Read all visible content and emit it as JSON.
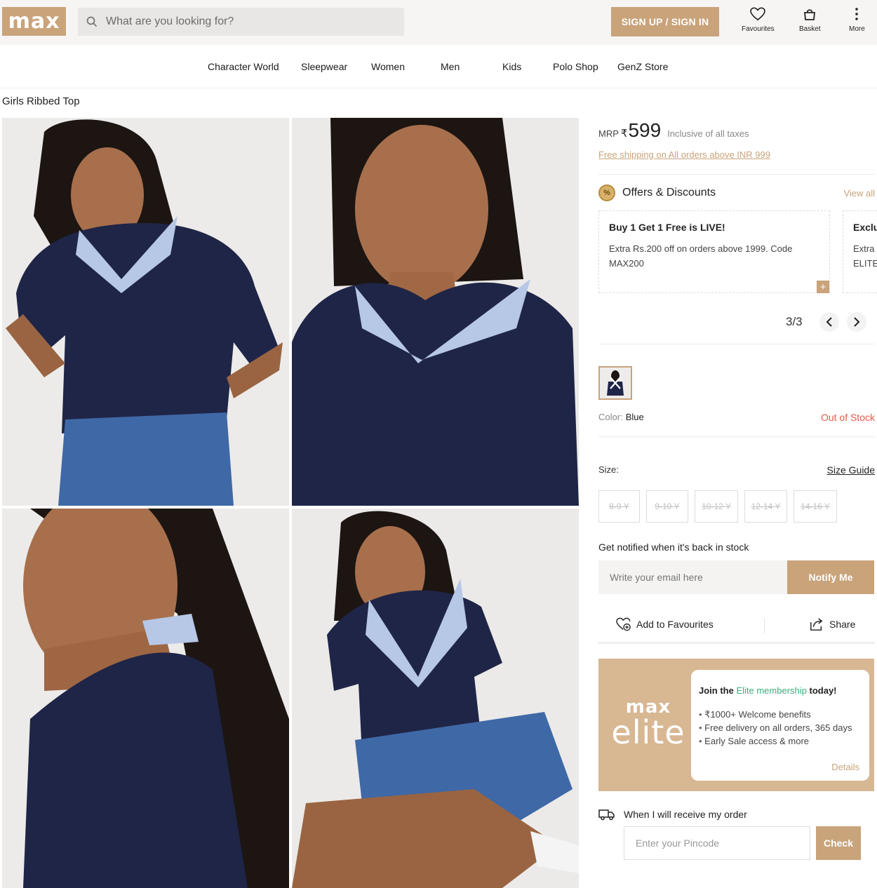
{
  "header": {
    "logo": "max",
    "search_placeholder": "What are you looking for?",
    "signin_label": "SIGN UP / SIGN IN",
    "favourites_label": "Favourites",
    "basket_label": "Basket",
    "more_label": "More"
  },
  "nav": [
    "Character World",
    "Sleepwear",
    "Women",
    "Men",
    "Kids",
    "Polo Shop",
    "GenZ Store"
  ],
  "product": {
    "title": "Girls Ribbed Top",
    "mrp_label": "MRP",
    "currency": "₹",
    "price": "599",
    "tax_note": "Inclusive of all taxes",
    "free_shipping": "Free shipping on All orders above INR 999"
  },
  "offers": {
    "title": "Offers & Discounts",
    "view_all": "View all",
    "badge": "%",
    "cards": [
      {
        "title": "Buy 1 Get 1 Free is LIVE!",
        "line1": "Extra Rs.200 off on orders above 1999. Code",
        "line2": "MAX200"
      },
      {
        "title": "Exclu",
        "line1": "Extra",
        "line2": "ELITE"
      }
    ],
    "pager": "3/3"
  },
  "color": {
    "label": "Color:",
    "value": "Blue",
    "stock": "Out of Stock"
  },
  "size": {
    "label": "Size:",
    "guide": "Size Guide",
    "options": [
      "8-9 Y",
      "9-10 Y",
      "10-12 Y",
      "12-14 Y",
      "14-16 Y"
    ]
  },
  "notify": {
    "title": "Get notified when it's back in stock",
    "placeholder": "Write your email here",
    "button": "Notify Me"
  },
  "actions": {
    "favourites": "Add to Favourites",
    "share": "Share"
  },
  "elite": {
    "brand_top": "max",
    "brand_bottom": "elite",
    "head_pre": "Join the ",
    "head_highlight": "Elite membership",
    "head_post": " today!",
    "benefits": [
      "₹1000+ Welcome benefits",
      "Free delivery on all orders, 365 days",
      "Early Sale access & more"
    ],
    "details": "Details"
  },
  "delivery": {
    "title": "When I will receive my order",
    "placeholder": "Enter your Pincode",
    "button": "Check"
  },
  "colors": {
    "accent": "#c9a37a",
    "out_of_stock": "#e15a47",
    "elite_green": "#3cae7c",
    "navy_top": "#1f2547"
  }
}
